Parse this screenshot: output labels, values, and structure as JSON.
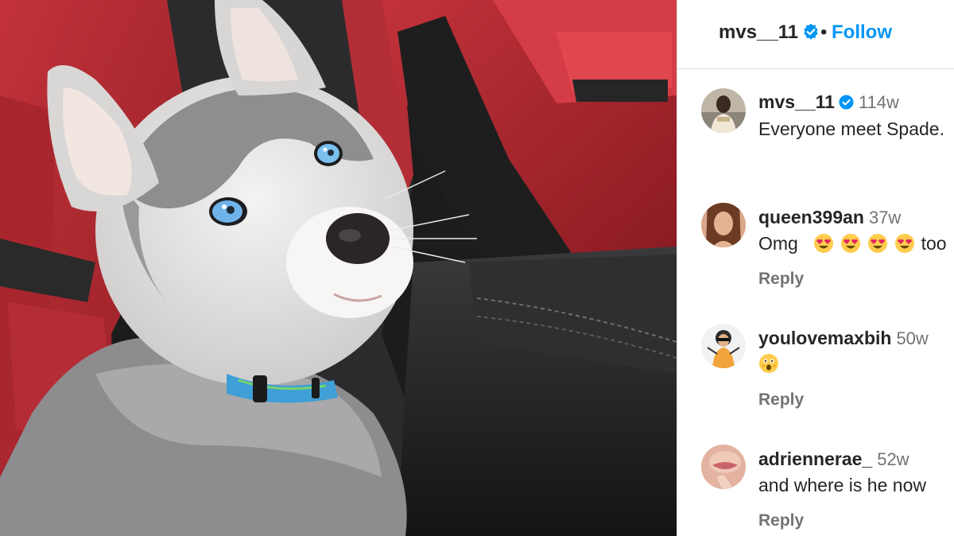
{
  "post": {
    "author": "mvs__11",
    "follow_label": "Follow",
    "dot": "•",
    "image_alt": "husky-puppy-photo"
  },
  "comments": [
    {
      "user": "mvs__11",
      "time": "114w",
      "text": "Everyone meet Spade.",
      "verified": true,
      "reply": ""
    },
    {
      "user": "queen399an",
      "time": "37w",
      "text_before": "Omg",
      "emojis": [
        "heart-eyes",
        "heart-eyes",
        "heart-eyes",
        "heart-eyes"
      ],
      "text_after": "too",
      "reply": "Reply"
    },
    {
      "user": "youlovemaxbih",
      "time": "50w",
      "emojis": [
        "astonished"
      ],
      "reply": "Reply"
    },
    {
      "user": "adriennerae_",
      "time": "52w",
      "text": "and where is he now",
      "reply": "Reply"
    }
  ],
  "colors": {
    "accent": "#0095f6",
    "verified": "#0095f6",
    "muted": "#737373"
  }
}
